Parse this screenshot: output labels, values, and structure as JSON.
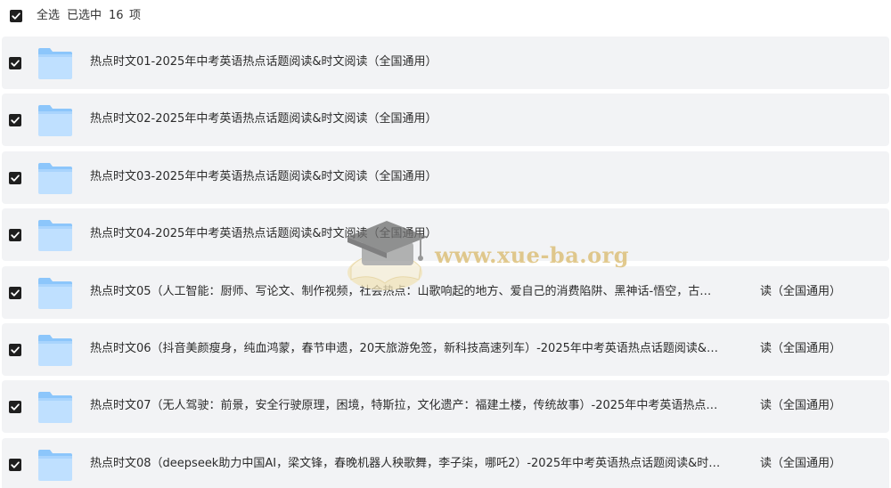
{
  "header": {
    "select_all": "全选",
    "selected_prefix": "已选中",
    "selected_count": "16",
    "selected_suffix": "项"
  },
  "rows": [
    {
      "label": "热点时文01-2025年中考英语热点话题阅读&时文阅读（全国通用）",
      "suffix": ""
    },
    {
      "label": "热点时文02-2025年中考英语热点话题阅读&时文阅读（全国通用）",
      "suffix": ""
    },
    {
      "label": "热点时文03-2025年中考英语热点话题阅读&时文阅读（全国通用）",
      "suffix": ""
    },
    {
      "label": "热点时文04-2025年中考英语热点话题阅读&时文阅读（全国通用）",
      "suffix": ""
    },
    {
      "label": "热点时文05（人工智能：厨师、写论文、制作视频，社会热点：山歌响起的地方、爱自己的消费陷阱、黑神话-悟空，古…",
      "suffix": "读（全国通用）"
    },
    {
      "label": "热点时文06（抖音美颜瘦身，纯血鸿蒙，春节申遗，20天旅游免签，新科技高速列车）-2025年中考英语热点话题阅读&…",
      "suffix": "读（全国通用）"
    },
    {
      "label": "热点时文07（无人驾驶：前景，安全行驶原理，困境，特斯拉，文化遗产：福建土楼，传统故事）-2025年中考英语热点…",
      "suffix": "读（全国通用）"
    },
    {
      "label": "热点时文08（deepseek助力中国AI，梁文锋，春晚机器人秧歌舞，李子柒，哪吒2）-2025年中考英语热点话题阅读&时…",
      "suffix": "读（全国通用）"
    }
  ],
  "icons": {
    "checkbox": "checkbox-checked-icon",
    "folder": "folder-icon"
  },
  "watermark": {
    "text": "www.xue-ba.org"
  },
  "colors": {
    "checkbox": "#1f1f1f",
    "row_bg": "#f2f3f5",
    "folder_light": "#bfe0ff",
    "folder_dark": "#8cc6fb",
    "watermark": "#d9b96a"
  }
}
